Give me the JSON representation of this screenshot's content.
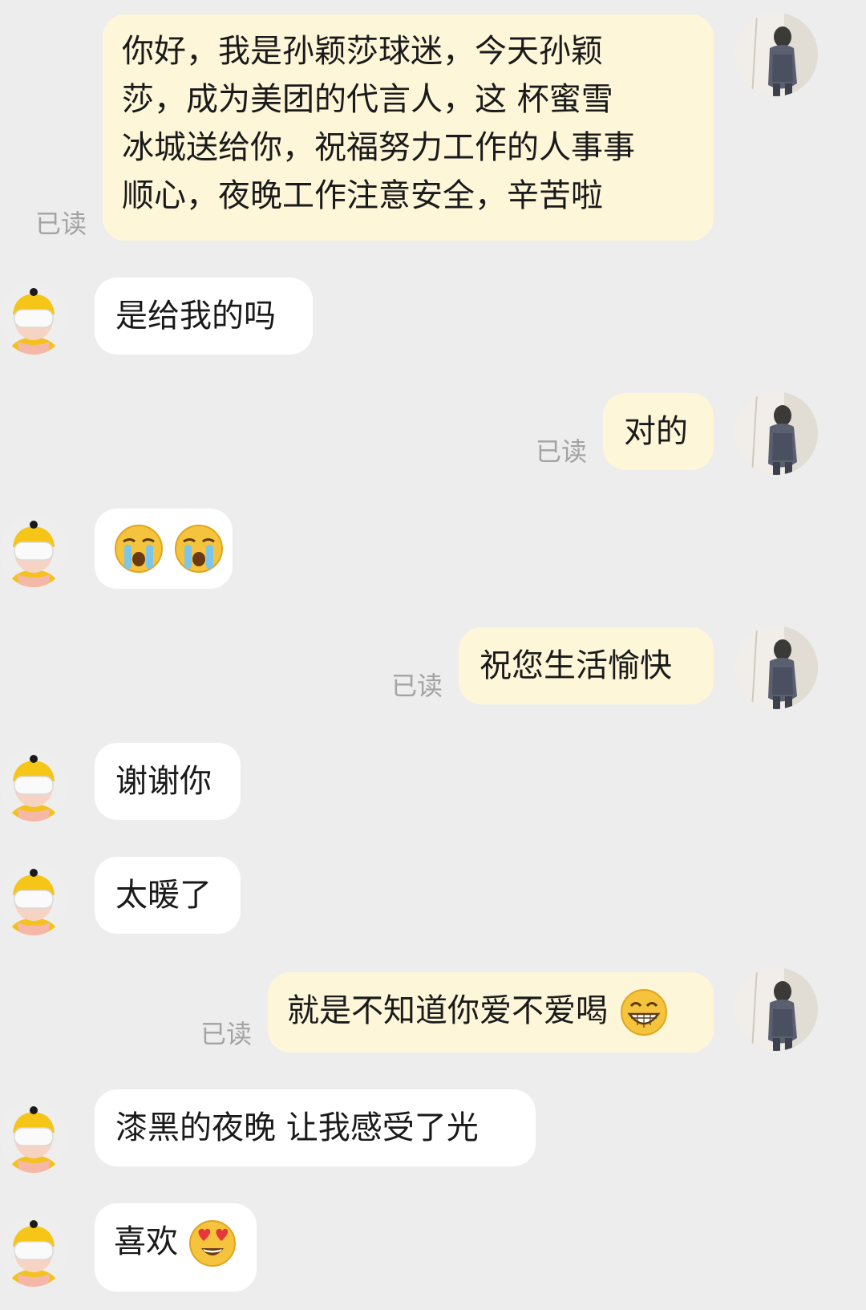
{
  "read_label": "已读",
  "messages": [
    {
      "from": "me",
      "lines": [
        "你好，我是孙颖莎球迷，今天孙颖",
        "莎，成为美团的代言人，这 杯蜜雪",
        "冰城送给你，祝福努力工作的人事事",
        "顺心，夜晚工作注意安全，辛苦啦"
      ],
      "read": true
    },
    {
      "from": "other",
      "text": "是给我的吗"
    },
    {
      "from": "me",
      "text": "对的",
      "read": true
    },
    {
      "from": "other",
      "emoji": [
        "crying-face",
        "crying-face"
      ]
    },
    {
      "from": "me",
      "text": "祝您生活愉快",
      "read": true
    },
    {
      "from": "other",
      "text": "谢谢你"
    },
    {
      "from": "other",
      "text": "太暖了"
    },
    {
      "from": "me",
      "text": "就是不知道你爱不爱喝",
      "emoji": "grinning-face",
      "read": true
    },
    {
      "from": "other",
      "text": "漆黑的夜晚 让我感受了光"
    },
    {
      "from": "other",
      "text": "喜欢",
      "emoji": "heart-eyes-face"
    }
  ]
}
